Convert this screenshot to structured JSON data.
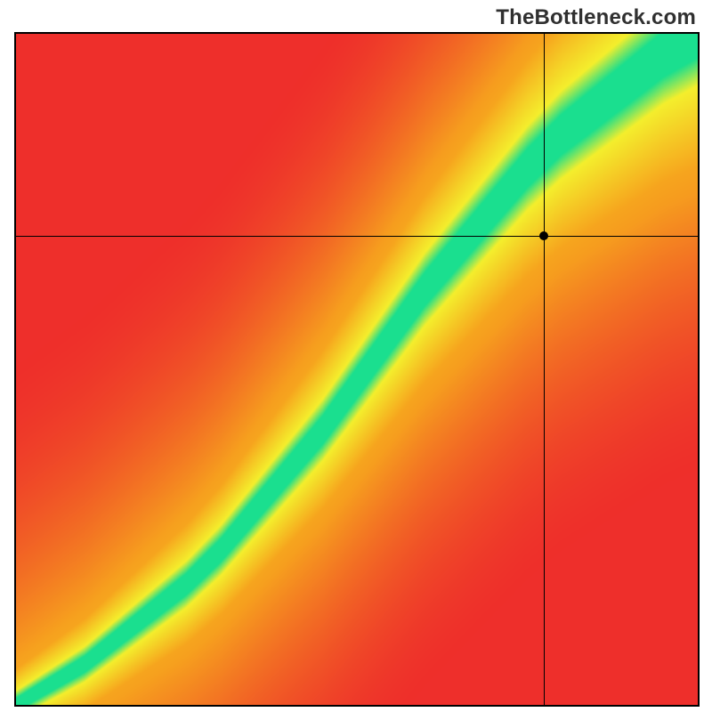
{
  "watermark": "TheBottleneck.com",
  "chart_data": {
    "type": "heatmap",
    "title": "",
    "xlabel": "",
    "ylabel": "",
    "xlim": [
      0,
      100
    ],
    "ylim": [
      0,
      100
    ],
    "marker": {
      "x": 77,
      "y": 70
    },
    "crosshair": {
      "x": 77,
      "y": 70
    },
    "ridge_curve": {
      "description": "green optimal band centerline, normalized to [0,1]x[0,1] with origin at bottom-left",
      "points": [
        {
          "x": 0.0,
          "y": 0.0
        },
        {
          "x": 0.05,
          "y": 0.03
        },
        {
          "x": 0.1,
          "y": 0.06
        },
        {
          "x": 0.15,
          "y": 0.1
        },
        {
          "x": 0.2,
          "y": 0.14
        },
        {
          "x": 0.25,
          "y": 0.18
        },
        {
          "x": 0.3,
          "y": 0.23
        },
        {
          "x": 0.35,
          "y": 0.29
        },
        {
          "x": 0.4,
          "y": 0.35
        },
        {
          "x": 0.45,
          "y": 0.41
        },
        {
          "x": 0.5,
          "y": 0.48
        },
        {
          "x": 0.55,
          "y": 0.55
        },
        {
          "x": 0.6,
          "y": 0.62
        },
        {
          "x": 0.65,
          "y": 0.68
        },
        {
          "x": 0.7,
          "y": 0.74
        },
        {
          "x": 0.75,
          "y": 0.8
        },
        {
          "x": 0.8,
          "y": 0.85
        },
        {
          "x": 0.85,
          "y": 0.89
        },
        {
          "x": 0.9,
          "y": 0.93
        },
        {
          "x": 0.95,
          "y": 0.97
        },
        {
          "x": 1.0,
          "y": 1.0
        }
      ]
    },
    "band": {
      "inner_width": 0.035,
      "outer_width": 0.09
    },
    "colors": {
      "green": "#1adf8f",
      "yellow": "#f4ef2d",
      "orange": "#f7a51e",
      "red": "#ee2f2b"
    }
  }
}
